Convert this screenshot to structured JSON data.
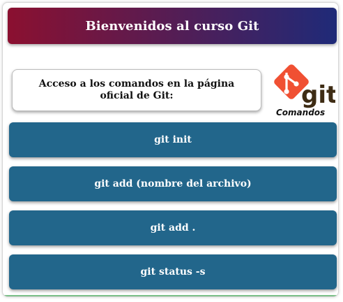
{
  "header": {
    "title": "Bienvenidos al curso Git",
    "gradient_start": "#8b1030",
    "gradient_end": "#1f2a78"
  },
  "info": {
    "text": "Acceso a los comandos en la página oficial de Git:"
  },
  "logo": {
    "icon": "git-logo-icon",
    "wordmark": "git",
    "caption": "Comandos",
    "diamond_color": "#f05033"
  },
  "commands": {
    "color": "#22668b",
    "items": [
      {
        "label": "git init"
      },
      {
        "label": "git add (nombre del archivo)"
      },
      {
        "label": "git add ."
      },
      {
        "label": "git status -s"
      }
    ]
  }
}
